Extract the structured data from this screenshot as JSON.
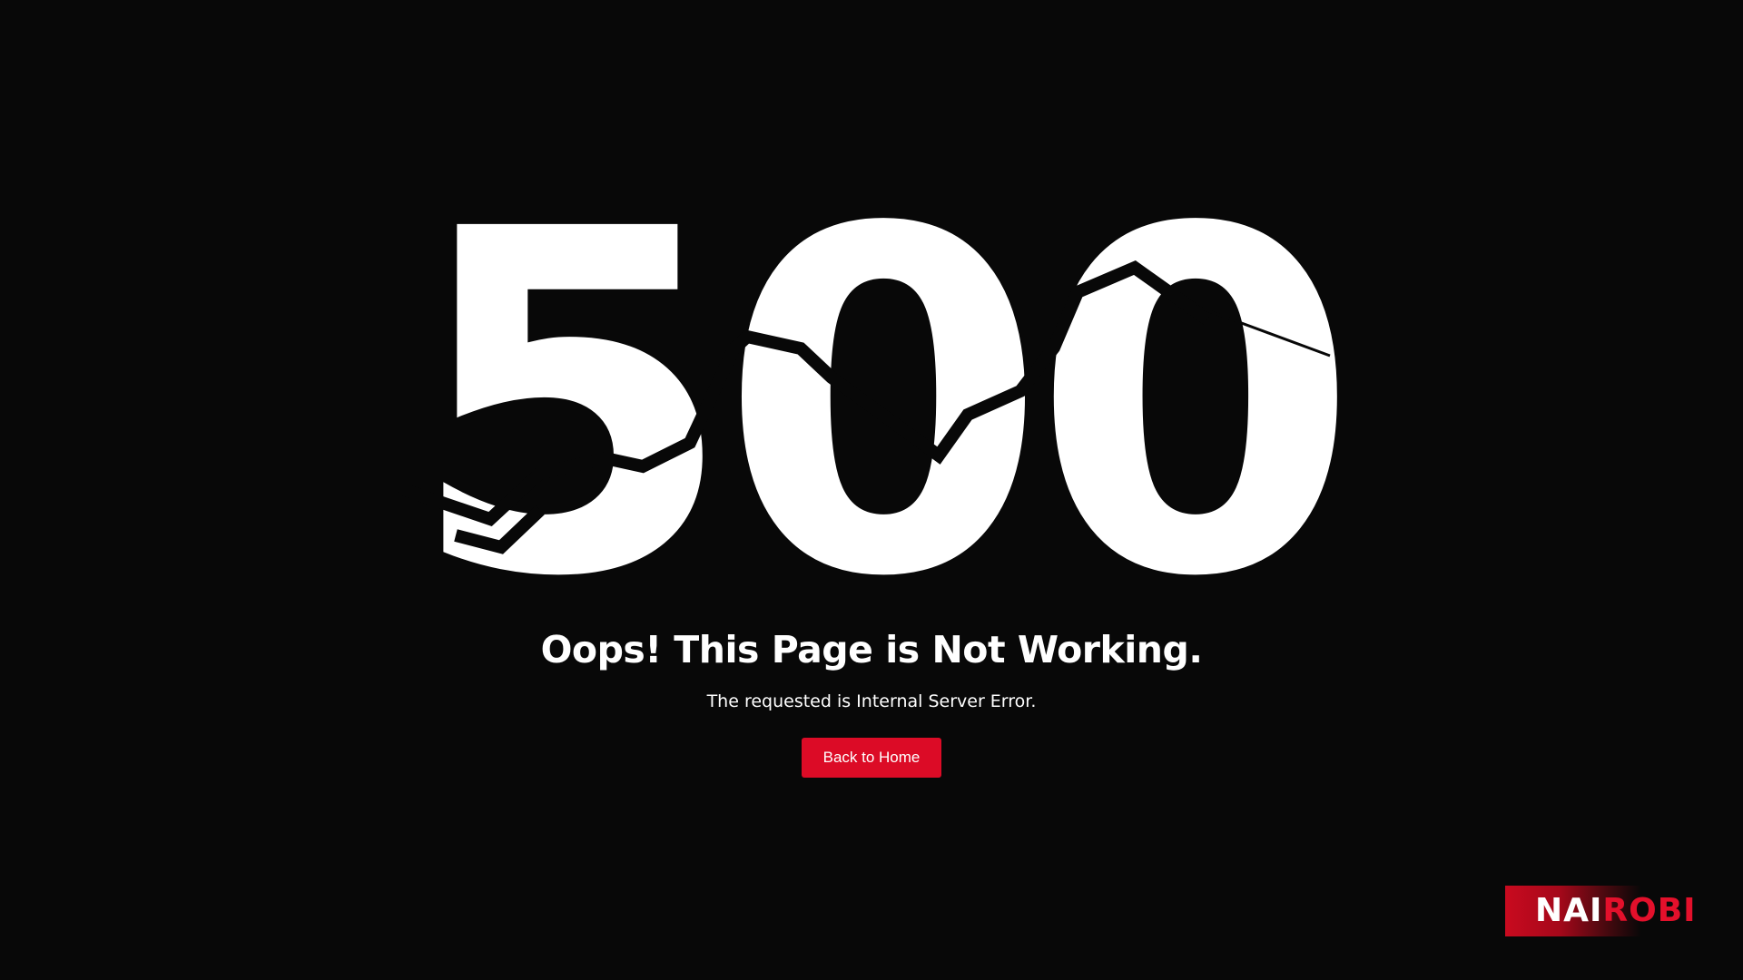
{
  "error": {
    "code": "500",
    "headline": "Oops! This Page is Not Working.",
    "message": "The requested is Internal Server Error.",
    "button_label": "Back to Home"
  },
  "brand": {
    "part_white": "NAI",
    "part_red": "ROBI"
  },
  "colors": {
    "background": "#080808",
    "text": "#ffffff",
    "accent": "#dc0b26"
  }
}
